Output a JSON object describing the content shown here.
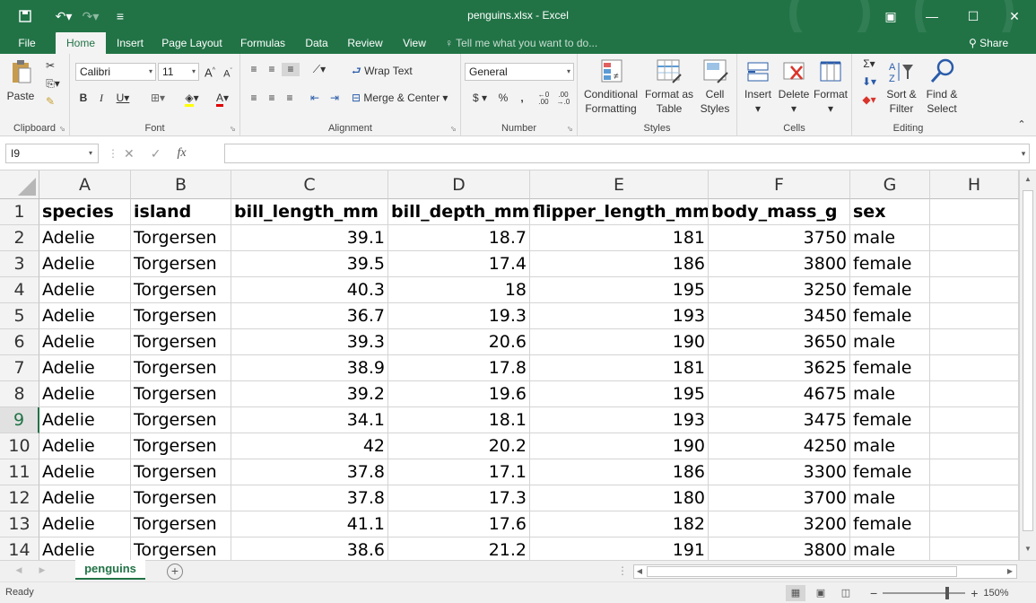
{
  "window": {
    "title": "penguins.xlsx - Excel",
    "share_label": "Share"
  },
  "tabs": [
    "File",
    "Home",
    "Insert",
    "Page Layout",
    "Formulas",
    "Data",
    "Review",
    "View"
  ],
  "tell_me": "Tell me what you want to do...",
  "ribbon": {
    "clipboard": {
      "label": "Clipboard",
      "paste": "Paste"
    },
    "font": {
      "label": "Font",
      "name": "Calibri",
      "size": "11"
    },
    "alignment": {
      "label": "Alignment",
      "wrap_text": "Wrap Text",
      "merge_center": "Merge & Center"
    },
    "number": {
      "label": "Number",
      "format": "General"
    },
    "styles": {
      "label": "Styles",
      "conditional_1": "Conditional",
      "conditional_2": "Formatting",
      "format_as_1": "Format as",
      "format_as_2": "Table",
      "cell_styles_1": "Cell",
      "cell_styles_2": "Styles"
    },
    "cells": {
      "label": "Cells",
      "insert": "Insert",
      "delete": "Delete",
      "format": "Format"
    },
    "editing": {
      "label": "Editing",
      "sort_1": "Sort &",
      "sort_2": "Filter",
      "find_1": "Find &",
      "find_2": "Select"
    }
  },
  "formula_bar": {
    "name_box": "I9",
    "value": ""
  },
  "grid": {
    "columns": [
      "A",
      "B",
      "C",
      "D",
      "E",
      "F",
      "G",
      "H"
    ],
    "active_row": 9,
    "rows": [
      [
        "species",
        "island",
        "bill_length_mm",
        "bill_depth_mm",
        "flipper_length_mm",
        "body_mass_g",
        "sex",
        ""
      ],
      [
        "Adelie",
        "Torgersen",
        "39.1",
        "18.7",
        "181",
        "3750",
        "male",
        ""
      ],
      [
        "Adelie",
        "Torgersen",
        "39.5",
        "17.4",
        "186",
        "3800",
        "female",
        ""
      ],
      [
        "Adelie",
        "Torgersen",
        "40.3",
        "18",
        "195",
        "3250",
        "female",
        ""
      ],
      [
        "Adelie",
        "Torgersen",
        "36.7",
        "19.3",
        "193",
        "3450",
        "female",
        ""
      ],
      [
        "Adelie",
        "Torgersen",
        "39.3",
        "20.6",
        "190",
        "3650",
        "male",
        ""
      ],
      [
        "Adelie",
        "Torgersen",
        "38.9",
        "17.8",
        "181",
        "3625",
        "female",
        ""
      ],
      [
        "Adelie",
        "Torgersen",
        "39.2",
        "19.6",
        "195",
        "4675",
        "male",
        ""
      ],
      [
        "Adelie",
        "Torgersen",
        "34.1",
        "18.1",
        "193",
        "3475",
        "female",
        ""
      ],
      [
        "Adelie",
        "Torgersen",
        "42",
        "20.2",
        "190",
        "4250",
        "male",
        ""
      ],
      [
        "Adelie",
        "Torgersen",
        "37.8",
        "17.1",
        "186",
        "3300",
        "female",
        ""
      ],
      [
        "Adelie",
        "Torgersen",
        "37.8",
        "17.3",
        "180",
        "3700",
        "male",
        ""
      ],
      [
        "Adelie",
        "Torgersen",
        "41.1",
        "17.6",
        "182",
        "3200",
        "female",
        ""
      ],
      [
        "Adelie",
        "Torgersen",
        "38.6",
        "21.2",
        "191",
        "3800",
        "male",
        ""
      ]
    ]
  },
  "sheet_tab": "penguins",
  "status": {
    "text": "Ready",
    "zoom": "150%"
  },
  "colors": {
    "accent": "#217346"
  }
}
